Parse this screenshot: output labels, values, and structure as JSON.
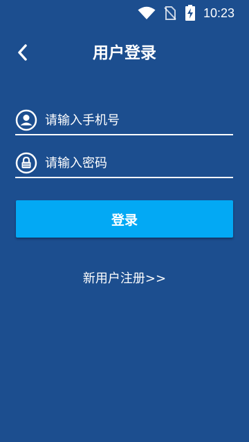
{
  "status_bar": {
    "time": "10:23",
    "icons": [
      "wifi-icon",
      "no-sim-icon",
      "battery-charging-icon"
    ]
  },
  "header": {
    "back_icon": "chevron-left-icon",
    "title": "用户登录"
  },
  "login_form": {
    "phone": {
      "icon": "user-circle-icon",
      "value": "",
      "placeholder": "请输入手机号"
    },
    "password": {
      "icon": "lock-circle-icon",
      "value": "",
      "placeholder": "请输入密码"
    },
    "submit_label": "登录"
  },
  "register_link": "新用户注册>>",
  "colors": {
    "background": "#1c4e8f",
    "button": "#03a9f4",
    "text": "#ffffff"
  }
}
